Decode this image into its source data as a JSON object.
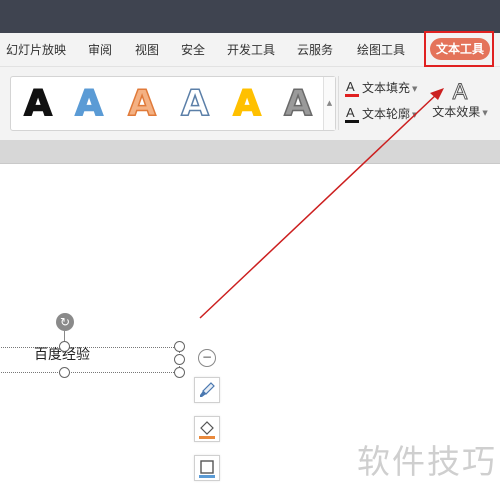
{
  "menubar": {
    "items": [
      "幻灯片放映",
      "审阅",
      "视图",
      "安全",
      "开发工具",
      "云服务",
      "绘图工具"
    ],
    "active": "文本工具"
  },
  "ribbon": {
    "text_styles": [
      {
        "glyph": "A",
        "fill": "#111111",
        "stroke": "#111111"
      },
      {
        "glyph": "A",
        "fill": "#5b9bd5",
        "stroke": "#5b9bd5"
      },
      {
        "glyph": "A",
        "fill": "#f4b183",
        "stroke": "#e07a3a"
      },
      {
        "glyph": "A",
        "fill": "#ffffff",
        "stroke": "#5b7fa8"
      },
      {
        "glyph": "A",
        "fill": "#ffc000",
        "stroke": "#ffc000"
      },
      {
        "glyph": "A",
        "fill": "#9a9a9a",
        "stroke": "#6a6a6a"
      }
    ],
    "text_fill": {
      "label": "文本填充",
      "icon": "A",
      "color": "#e02020"
    },
    "text_outline": {
      "label": "文本轮廓",
      "icon": "A",
      "color": "#111111"
    },
    "text_effect": {
      "label": "文本效果",
      "icon": "A"
    }
  },
  "canvas": {
    "textbox_text": "百度经验",
    "watermark": "软件技巧"
  },
  "colors": {
    "titlebar": "#3f4450",
    "active_tab": "#e4735a",
    "highlight": "#e02020",
    "arrow": "#cc1f1f"
  }
}
